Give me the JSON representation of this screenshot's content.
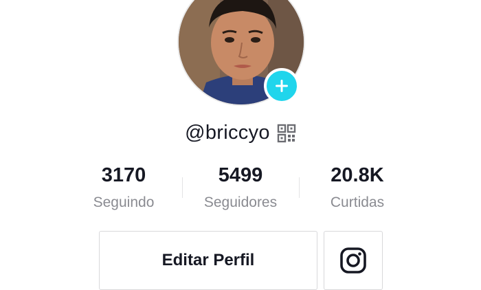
{
  "profile": {
    "username": "@briccyo",
    "avatar_icon": "profile-photo",
    "add_icon": "plus-icon",
    "qr_icon": "qr-code-icon"
  },
  "stats": [
    {
      "value": "3170",
      "label": "Seguindo"
    },
    {
      "value": "5499",
      "label": "Seguidores"
    },
    {
      "value": "20.8K",
      "label": "Curtidas"
    }
  ],
  "actions": {
    "edit_label": "Editar Perfil",
    "instagram_icon": "instagram-icon"
  },
  "colors": {
    "accent": "#20d5ec",
    "text": "#161823",
    "muted": "#8a8b91",
    "border": "#d8d8da"
  }
}
